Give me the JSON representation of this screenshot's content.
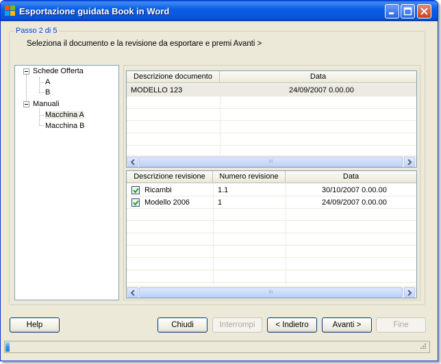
{
  "window": {
    "title": "Esportazione guidata Book in Word",
    "accent": "#0a54d8"
  },
  "wizard": {
    "step": "Passo 2 di 5",
    "instruction": "Seleziona il documento e la revisione da esportare e premi Avanti >"
  },
  "tree": {
    "nodes": [
      {
        "label": "Schede Offerta"
      },
      {
        "label": "A"
      },
      {
        "label": "B"
      },
      {
        "label": "Manuali"
      },
      {
        "label": "Macchina A"
      },
      {
        "label": "Macchina B"
      }
    ]
  },
  "documents": {
    "columns": [
      "Descrizione documento",
      "Data"
    ],
    "rows": [
      {
        "descrizione": "MODELLO 123",
        "data": "24/09/2007 0.00.00"
      }
    ]
  },
  "revisions": {
    "columns": [
      "Descrizione revisione",
      "Numero revisione",
      "Data"
    ],
    "rows": [
      {
        "descrizione": "Ricambi",
        "numero": "1.1",
        "data": "30/10/2007 0.00.00"
      },
      {
        "descrizione": "Modello 2006",
        "numero": "1",
        "data": "24/09/2007 0.00.00"
      }
    ]
  },
  "buttons": {
    "help": "Help",
    "close": "Chiudi",
    "stop": "Interrompi",
    "back": "< Indietro",
    "next": "Avanti >",
    "finish": "Fine"
  },
  "scroll_grip": "III",
  "progress": {
    "fraction": 0.01
  }
}
